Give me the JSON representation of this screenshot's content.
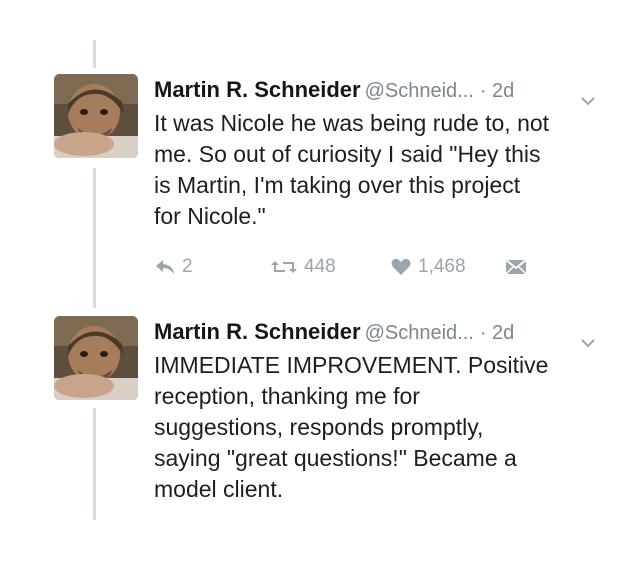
{
  "colors": {
    "name": "#14171a",
    "muted": "#7a8790",
    "icon": "#9aa5ad",
    "thread_line": "#d6dde3"
  },
  "tweets": [
    {
      "display_name": "Martin R. Schneider",
      "handle": "@Schneid...",
      "time": "· 2d",
      "text_lines": [
        "It was Nicole he was being rude to, not",
        "me. So out of curiosity I said \"Hey this",
        "is Martin, I'm taking over this project",
        "for Nicole.\""
      ],
      "actions": {
        "reply_count": "2",
        "retweet_count": "448",
        "like_count": "1,468"
      },
      "icons": [
        "reply-icon",
        "retweet-icon",
        "heart-icon",
        "direct-message-icon",
        "chevron-down-icon"
      ]
    },
    {
      "display_name": "Martin R. Schneider",
      "handle": "@Schneid...",
      "time": "· 2d",
      "text_lines": [
        "IMMEDIATE IMPROVEMENT. Positive",
        "reception, thanking me for",
        "suggestions, responds promptly,",
        "saying \"great questions!\" Became a",
        "model client."
      ],
      "icons": [
        "chevron-down-icon"
      ]
    }
  ]
}
